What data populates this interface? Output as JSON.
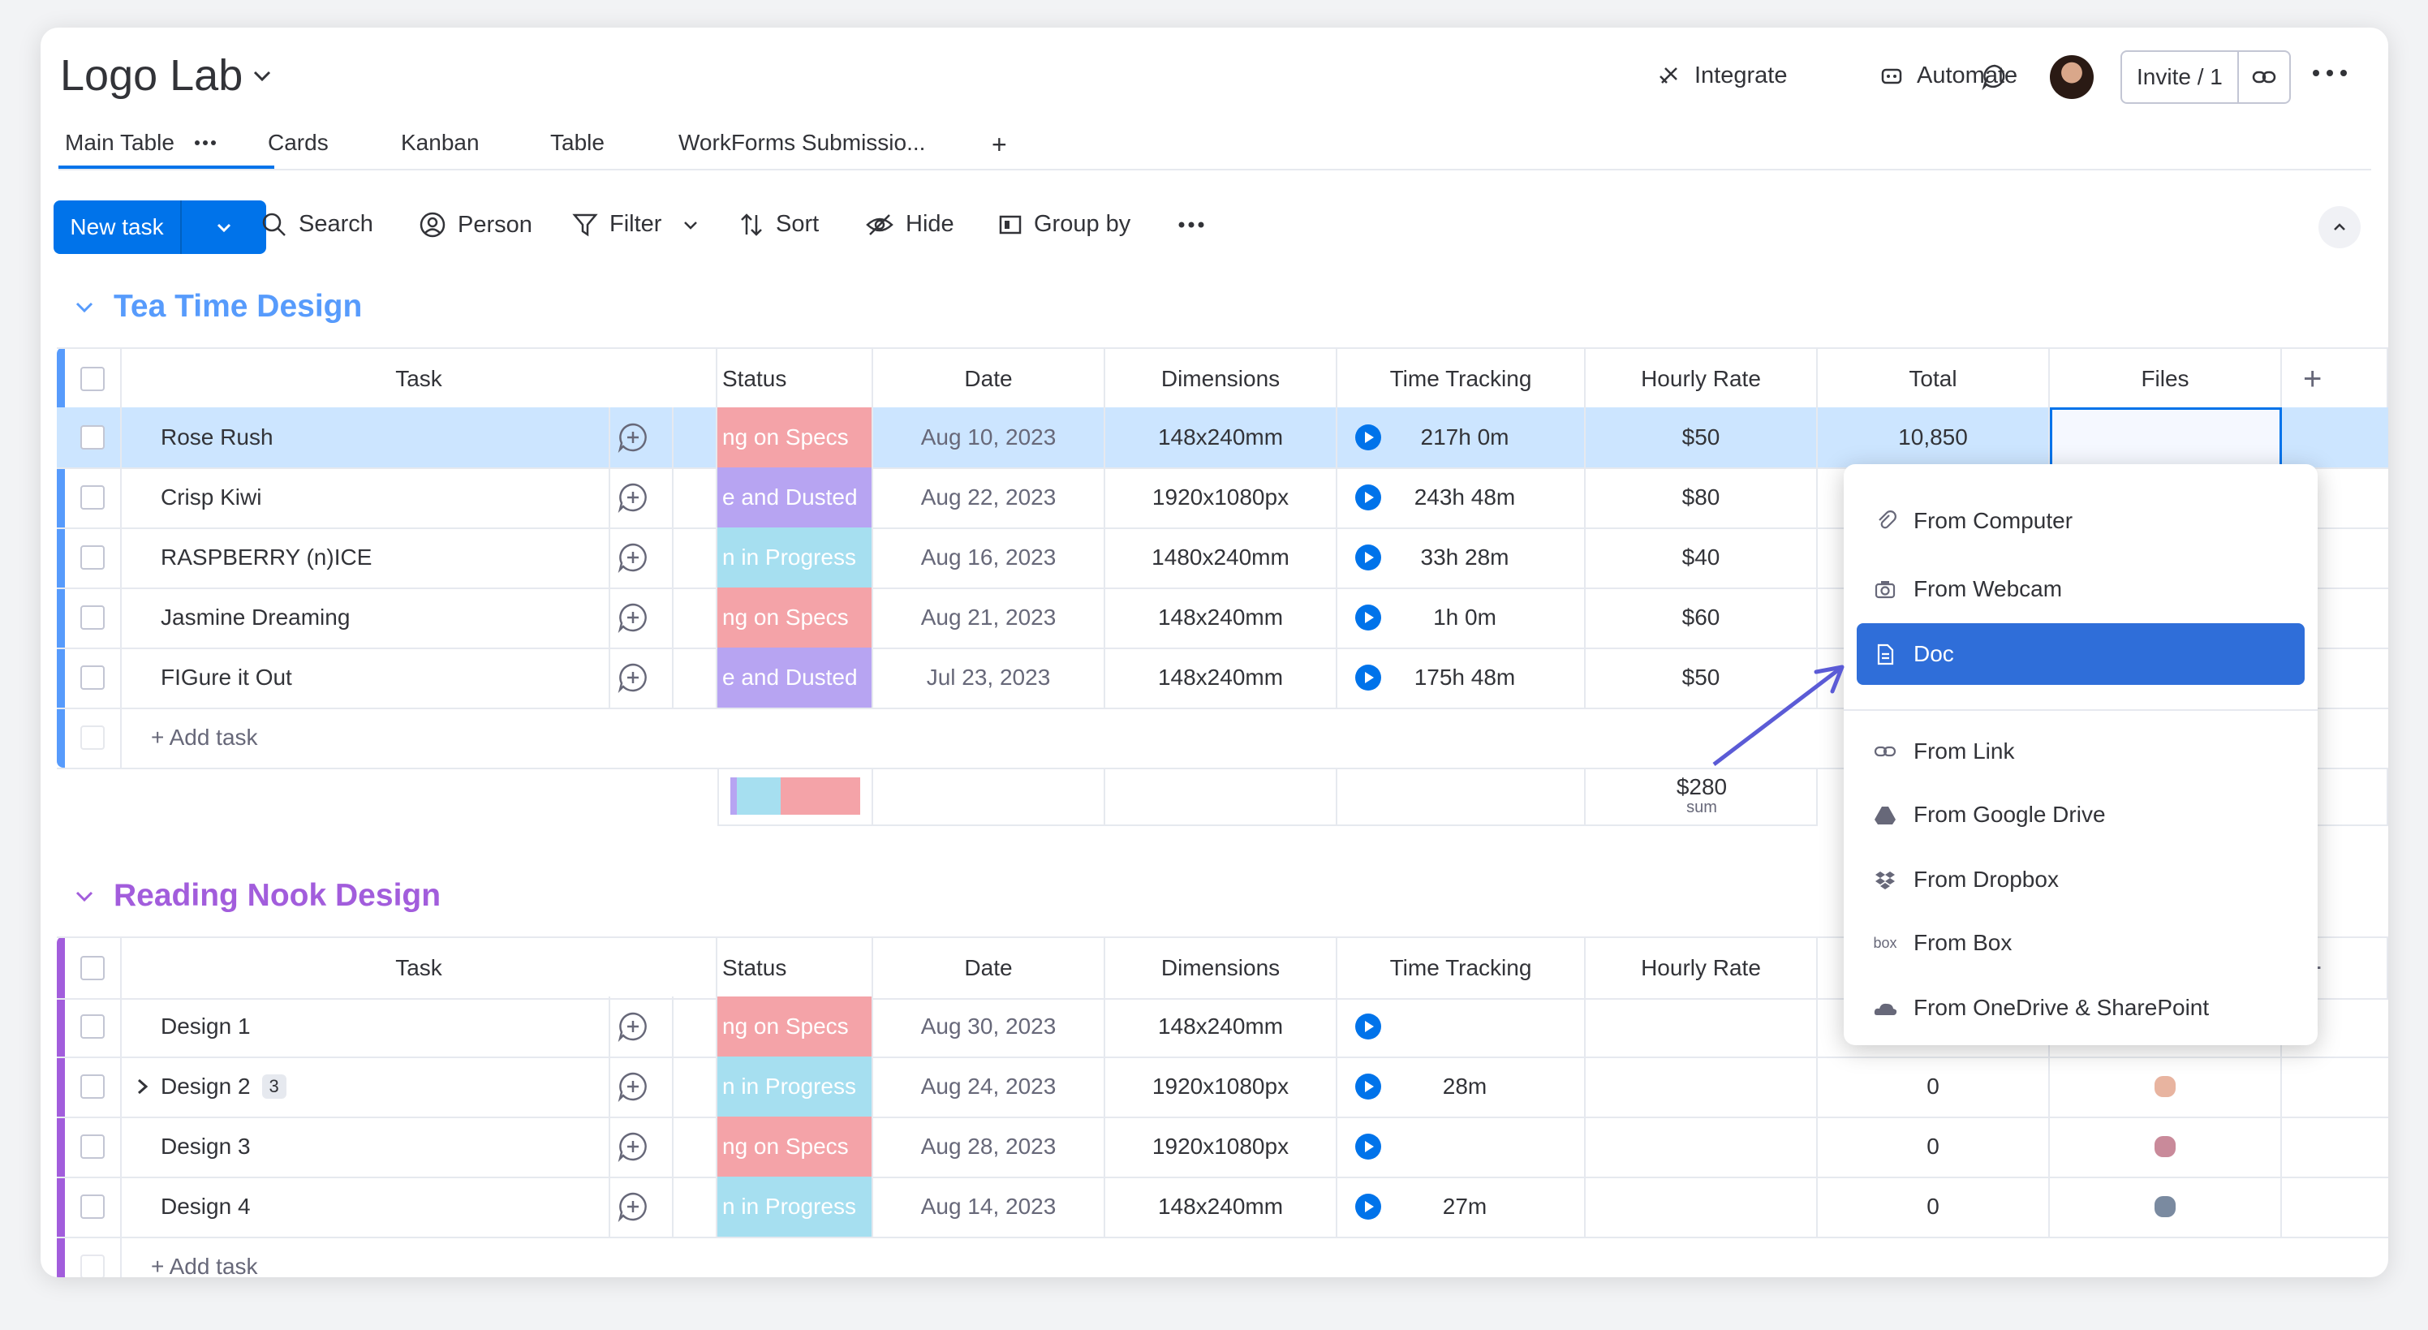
{
  "header": {
    "board_title": "Logo Lab",
    "integrate_label": "Integrate",
    "automate_label": "Automate",
    "invite_label": "Invite / 1"
  },
  "tabs": [
    {
      "label": "Main Table",
      "active": true
    },
    {
      "label": "Cards"
    },
    {
      "label": "Kanban"
    },
    {
      "label": "Table"
    },
    {
      "label": "WorkForms Submissio..."
    },
    {
      "label": "+"
    }
  ],
  "toolbar": {
    "new_task_label": "New task",
    "search_label": "Search",
    "person_label": "Person",
    "filter_label": "Filter",
    "sort_label": "Sort",
    "hide_label": "Hide",
    "group_by_label": "Group by"
  },
  "columns": [
    "Task",
    "Status",
    "Date",
    "Dimensions",
    "Time Tracking",
    "Hourly Rate",
    "Total",
    "Files"
  ],
  "colors": {
    "accent": "#0073ea",
    "group1": "#579bfc",
    "group2": "#a25ddc",
    "status_specs": "#f4a3a8",
    "status_dusted": "#b7a4f2",
    "status_progress": "#a6dff0",
    "dropdown_active": "#2f6ed9"
  },
  "group1": {
    "title": "Tea Time Design",
    "rows": [
      {
        "task": "Rose Rush",
        "status": "ng on Specs",
        "status_kind": "specs",
        "date": "Aug 10, 2023",
        "dimensions": "148x240mm",
        "time": "217h 0m",
        "rate": "$50",
        "total": "10,850"
      },
      {
        "task": "Crisp Kiwi",
        "status": "e and Dusted",
        "status_kind": "dusted",
        "date": "Aug 22, 2023",
        "dimensions": "1920x1080px",
        "time": "243h 48m",
        "rate": "$80",
        "total": ""
      },
      {
        "task": "RASPBERRY (n)ICE",
        "status": "n in Progress",
        "status_kind": "progress",
        "date": "Aug 16, 2023",
        "dimensions": "1480x240mm",
        "time": "33h 28m",
        "rate": "$40",
        "total": ""
      },
      {
        "task": "Jasmine Dreaming",
        "status": "ng on Specs",
        "status_kind": "specs",
        "date": "Aug 21, 2023",
        "dimensions": "148x240mm",
        "time": "1h 0m",
        "rate": "$60",
        "total": ""
      },
      {
        "task": "FIGure it Out",
        "status": "e and Dusted",
        "status_kind": "dusted",
        "date": "Jul 23, 2023",
        "dimensions": "148x240mm",
        "time": "175h 48m",
        "rate": "$50",
        "total": ""
      }
    ],
    "add_task_label": "+ Add task",
    "summary_value": "$280",
    "summary_label": "sum"
  },
  "group2": {
    "title": "Reading Nook Design",
    "rows": [
      {
        "task": "Design 1",
        "status": "ng on Specs",
        "status_kind": "specs",
        "date": "Aug 30, 2023",
        "dimensions": "148x240mm",
        "time": "",
        "rate": "",
        "total": "0"
      },
      {
        "task": "Design 2",
        "subitems": "3",
        "status": "n in Progress",
        "status_kind": "progress",
        "date": "Aug 24, 2023",
        "dimensions": "1920x1080px",
        "time": "28m",
        "rate": "",
        "total": "0"
      },
      {
        "task": "Design 3",
        "status": "ng on Specs",
        "status_kind": "specs",
        "date": "Aug 28, 2023",
        "dimensions": "1920x1080px",
        "time": "",
        "rate": "",
        "total": "0"
      },
      {
        "task": "Design 4",
        "status": "n in Progress",
        "status_kind": "progress",
        "date": "Aug 14, 2023",
        "dimensions": "148x240mm",
        "time": "27m",
        "rate": "",
        "total": "0"
      }
    ],
    "add_task_label": "+ Add task"
  },
  "files_menu": {
    "items": [
      {
        "label": "From Computer",
        "icon": "paperclip-icon"
      },
      {
        "label": "From Webcam",
        "icon": "camera-icon"
      },
      {
        "label": "Doc",
        "icon": "doc-icon",
        "active": true
      },
      {
        "label": "From Link",
        "icon": "link-icon"
      },
      {
        "label": "From Google Drive",
        "icon": "google-drive-icon"
      },
      {
        "label": "From Dropbox",
        "icon": "dropbox-icon"
      },
      {
        "label": "From Box",
        "icon": "box-icon",
        "icon_text": "box"
      },
      {
        "label": "From OneDrive & SharePoint",
        "icon": "onedrive-icon"
      }
    ]
  }
}
